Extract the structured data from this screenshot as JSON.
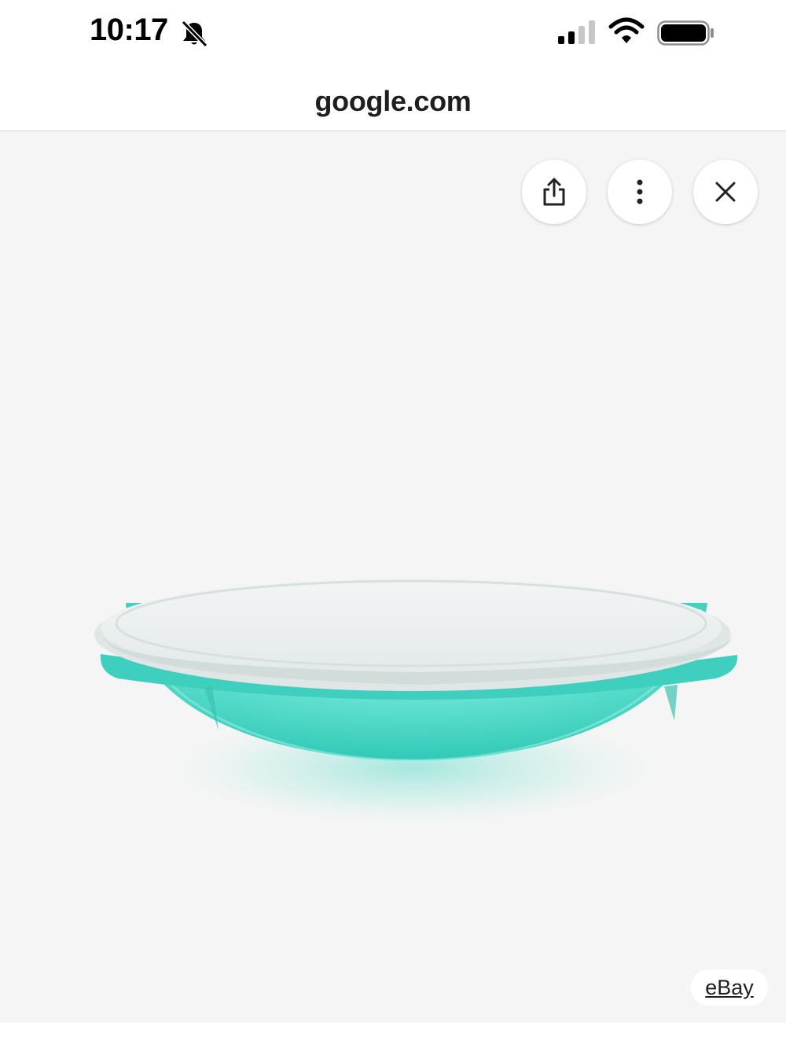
{
  "status_bar": {
    "time": "10:17",
    "icons": [
      "bell-slash-icon",
      "cellular-signal-icon",
      "wifi-icon",
      "battery-icon"
    ]
  },
  "browser": {
    "url": "google.com"
  },
  "image_viewer": {
    "background_color": "#f5f5f5",
    "actions": [
      "share-icon",
      "more-vertical-icon",
      "close-icon"
    ],
    "image_subject": "turquoise-bowl-with-clear-lid",
    "source_label": "eBay"
  },
  "colors": {
    "bowl": "#4fd9c7",
    "lid": "#e9eeee"
  }
}
